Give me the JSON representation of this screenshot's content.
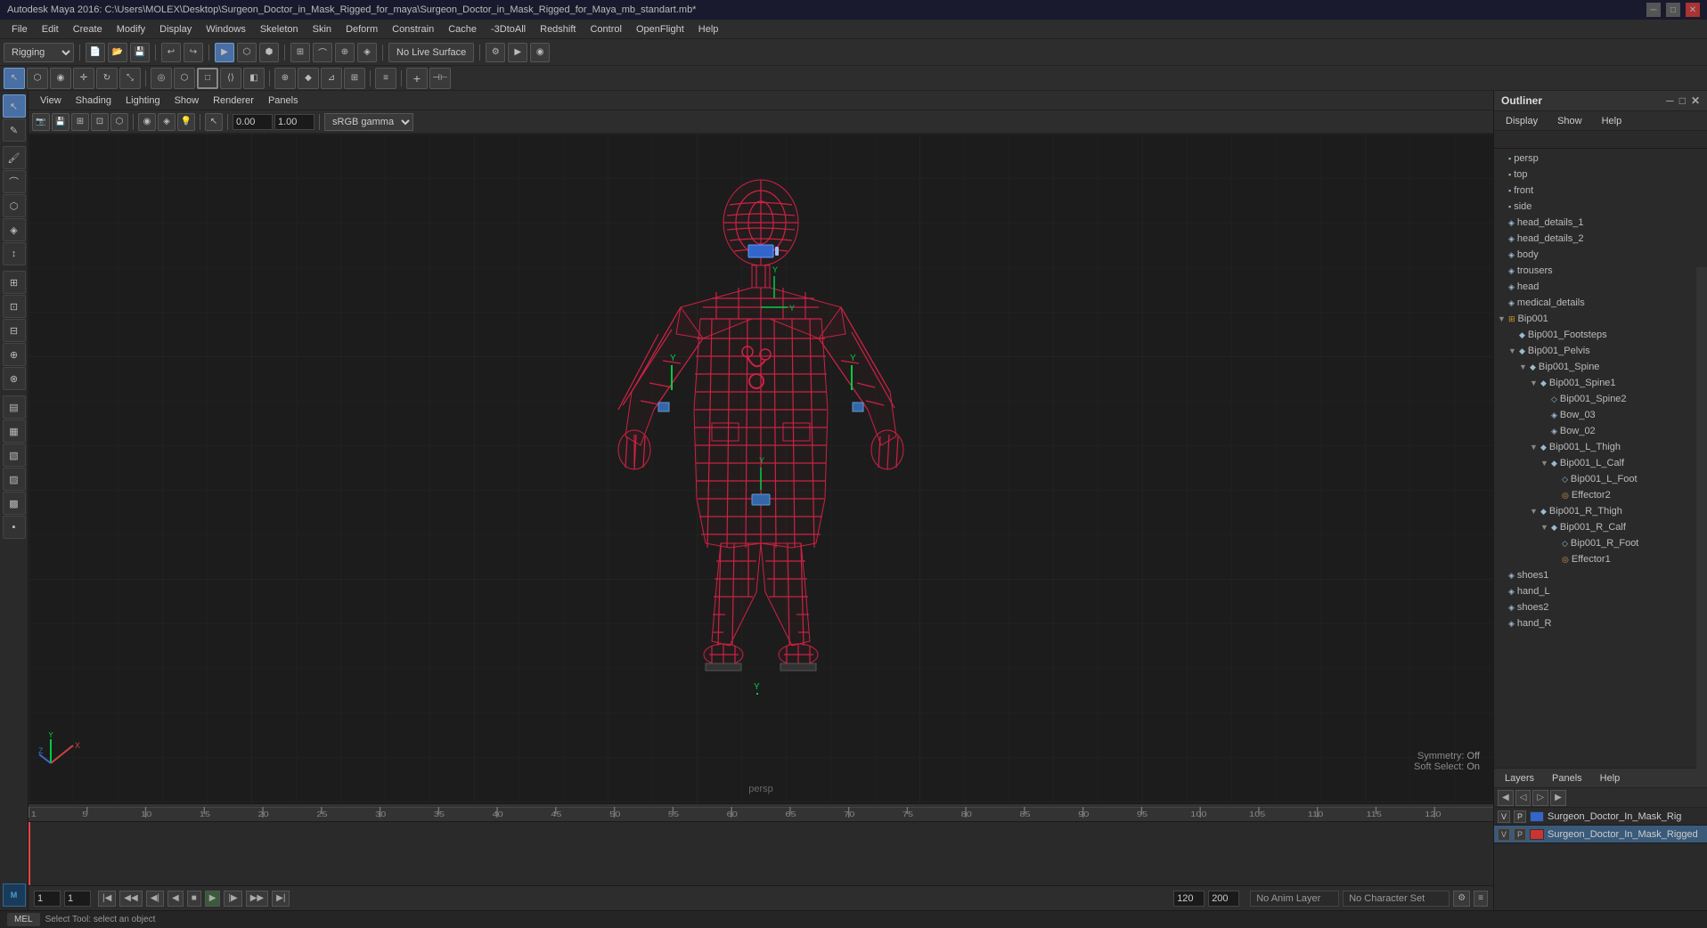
{
  "titlebar": {
    "title": "Autodesk Maya 2016: C:\\Users\\MOLEX\\Desktop\\Surgeon_Doctor_in_Mask_Rigged_for_maya\\Surgeon_Doctor_in_Mask_Rigged_for_Maya_mb_standart.mb*",
    "controls": [
      "─",
      "□",
      "✕"
    ]
  },
  "menubar": {
    "items": [
      "File",
      "Edit",
      "Create",
      "Modify",
      "Display",
      "Windows",
      "Skeleton",
      "Skin",
      "Deform",
      "Constrain",
      "Cache",
      "-3DtoAll",
      "Redshift",
      "Control",
      "OpenFlight",
      "Help"
    ]
  },
  "toolbar1": {
    "mode_dropdown": "Rigging",
    "no_live_surface": "No Live Surface"
  },
  "viewport_menu": {
    "items": [
      "View",
      "Shading",
      "Lighting",
      "Show",
      "Renderer",
      "Panels"
    ]
  },
  "viewport_bottom": {
    "symmetry_label": "Symmetry:",
    "symmetry_value": "Off",
    "soft_select_label": "Soft Select:",
    "soft_select_value": "On",
    "persp": "persp"
  },
  "outliner": {
    "title": "Outliner",
    "menu_items": [
      "Display",
      "Show",
      "Help"
    ],
    "items": [
      {
        "label": "persp",
        "indent": 0,
        "icon": "camera",
        "expanded": false
      },
      {
        "label": "top",
        "indent": 0,
        "icon": "camera",
        "expanded": false
      },
      {
        "label": "front",
        "indent": 0,
        "icon": "camera",
        "expanded": false
      },
      {
        "label": "side",
        "indent": 0,
        "icon": "camera",
        "expanded": false
      },
      {
        "label": "head_details_1",
        "indent": 0,
        "icon": "mesh",
        "expanded": false
      },
      {
        "label": "head_details_2",
        "indent": 0,
        "icon": "mesh",
        "expanded": false
      },
      {
        "label": "body",
        "indent": 0,
        "icon": "mesh",
        "expanded": false
      },
      {
        "label": "trousers",
        "indent": 0,
        "icon": "mesh",
        "expanded": false
      },
      {
        "label": "head",
        "indent": 0,
        "icon": "mesh",
        "expanded": false
      },
      {
        "label": "medical_details",
        "indent": 0,
        "icon": "mesh",
        "expanded": false
      },
      {
        "label": "Bip001",
        "indent": 0,
        "icon": "group",
        "expanded": true
      },
      {
        "label": "Bip001_Footsteps",
        "indent": 1,
        "icon": "joint",
        "expanded": false
      },
      {
        "label": "Bip001_Pelvis",
        "indent": 1,
        "icon": "joint",
        "expanded": true
      },
      {
        "label": "Bip001_Spine",
        "indent": 2,
        "icon": "joint",
        "expanded": true
      },
      {
        "label": "Bip001_Spine1",
        "indent": 3,
        "icon": "joint",
        "expanded": true
      },
      {
        "label": "Bip001_Spine2",
        "indent": 4,
        "icon": "joint",
        "expanded": false
      },
      {
        "label": "Bow_03",
        "indent": 4,
        "icon": "mesh",
        "expanded": false
      },
      {
        "label": "Bow_02",
        "indent": 4,
        "icon": "mesh",
        "expanded": false
      },
      {
        "label": "Bip001_L_Thigh",
        "indent": 3,
        "icon": "joint",
        "expanded": true
      },
      {
        "label": "Bip001_L_Calf",
        "indent": 4,
        "icon": "joint",
        "expanded": true
      },
      {
        "label": "Bip001_L_Foot",
        "indent": 5,
        "icon": "joint",
        "expanded": false
      },
      {
        "label": "Effector2",
        "indent": 5,
        "icon": "effector",
        "expanded": false
      },
      {
        "label": "Bip001_R_Thigh",
        "indent": 3,
        "icon": "joint",
        "expanded": true
      },
      {
        "label": "Bip001_R_Calf",
        "indent": 4,
        "icon": "joint",
        "expanded": true
      },
      {
        "label": "Bip001_R_Foot",
        "indent": 5,
        "icon": "joint",
        "expanded": false
      },
      {
        "label": "Effector1",
        "indent": 5,
        "icon": "effector",
        "expanded": false
      },
      {
        "label": "shoes1",
        "indent": 0,
        "icon": "mesh",
        "expanded": false
      },
      {
        "label": "hand_L",
        "indent": 0,
        "icon": "mesh",
        "expanded": false
      },
      {
        "label": "shoes2",
        "indent": 0,
        "icon": "mesh",
        "expanded": false
      },
      {
        "label": "hand_R",
        "indent": 0,
        "icon": "mesh",
        "expanded": false
      }
    ]
  },
  "layers": {
    "title_items": [
      "Layers",
      "Panels",
      "Help"
    ],
    "items": [
      {
        "v": "V",
        "p": "P",
        "color": "#3366cc",
        "name": "Surgeon_Doctor_In_Mask_Rig",
        "active": false
      },
      {
        "v": "V",
        "p": "P",
        "color": "#cc3333",
        "name": "Surgeon_Doctor_In_Mask_Rigged",
        "active": true
      }
    ]
  },
  "timeline": {
    "start": "1",
    "end": "120",
    "current": "1",
    "range_start": "1",
    "range_end": "120",
    "max": "200",
    "ticks": [
      "1",
      "5",
      "10",
      "15",
      "20",
      "25",
      "30",
      "35",
      "40",
      "45",
      "50",
      "55",
      "60",
      "65",
      "70",
      "75",
      "80",
      "85",
      "90",
      "95",
      "100",
      "105",
      "110",
      "115",
      "120"
    ]
  },
  "anim_bar": {
    "no_anim_layer": "No Anim Layer",
    "character_set": "No Character Set",
    "frame_current": "1",
    "frame_input": "1"
  },
  "statusbar": {
    "text": "Select Tool: select an object"
  },
  "viewport_num": {
    "value1": "0.00",
    "value2": "1.00",
    "color_mode": "sRGB gamma"
  },
  "left_tools": [
    "▶",
    "↕",
    "↔",
    "⟳",
    "◇",
    "⬡",
    "✦",
    "⊞",
    "⊡",
    "≡",
    "⊕",
    "↗",
    "⊿",
    "▤",
    "▦"
  ]
}
